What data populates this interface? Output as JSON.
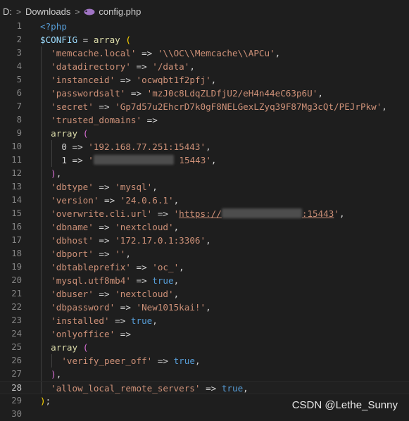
{
  "breadcrumb": {
    "drive": "D:",
    "folder": "Downloads",
    "file": "config.php",
    "file_icon": "php-elephant-icon",
    "separator": ">"
  },
  "editor": {
    "active_line": 28,
    "lines": [
      {
        "n": "1",
        "tokens": [
          [
            "k",
            "<?php"
          ]
        ]
      },
      {
        "n": "2",
        "tokens": [
          [
            "v",
            "$CONFIG"
          ],
          [
            "o",
            " = "
          ],
          [
            "f",
            "array"
          ],
          [
            "o",
            " "
          ],
          [
            "b",
            "("
          ]
        ]
      },
      {
        "n": "3",
        "tokens": [
          [
            "o",
            "  "
          ],
          [
            "s",
            "'memcache.local'"
          ],
          [
            "o",
            " => "
          ],
          [
            "s",
            "'\\\\OC\\\\Memcache\\\\APCu'"
          ],
          [
            "o",
            ","
          ]
        ]
      },
      {
        "n": "4",
        "tokens": [
          [
            "o",
            "  "
          ],
          [
            "s",
            "'datadirectory'"
          ],
          [
            "o",
            " => "
          ],
          [
            "s",
            "'/data'"
          ],
          [
            "o",
            ","
          ]
        ]
      },
      {
        "n": "5",
        "tokens": [
          [
            "o",
            "  "
          ],
          [
            "s",
            "'instanceid'"
          ],
          [
            "o",
            " => "
          ],
          [
            "s",
            "'ocwqbt1f2pfj'"
          ],
          [
            "o",
            ","
          ]
        ]
      },
      {
        "n": "6",
        "tokens": [
          [
            "o",
            "  "
          ],
          [
            "s",
            "'passwordsalt'"
          ],
          [
            "o",
            " => "
          ],
          [
            "s",
            "'mzJ0c8LdqZLDfjU2/eH4n44eC63p6U'"
          ],
          [
            "o",
            ","
          ]
        ]
      },
      {
        "n": "7",
        "tokens": [
          [
            "o",
            "  "
          ],
          [
            "s",
            "'secret'"
          ],
          [
            "o",
            " => "
          ],
          [
            "s",
            "'Gp7d57u2EhcrD7k0gF8NELGexLZyq39F87Mg3cQt/PEJrPkw'"
          ],
          [
            "o",
            ","
          ]
        ]
      },
      {
        "n": "8",
        "tokens": [
          [
            "o",
            "  "
          ],
          [
            "s",
            "'trusted_domains'"
          ],
          [
            "o",
            " =>"
          ]
        ]
      },
      {
        "n": "9",
        "tokens": [
          [
            "o",
            "  "
          ],
          [
            "f",
            "array"
          ],
          [
            "o",
            " "
          ],
          [
            "pb",
            "("
          ]
        ]
      },
      {
        "n": "10",
        "tokens": [
          [
            "o",
            "    0 => "
          ],
          [
            "s",
            "'192.168.77.251:15443'"
          ],
          [
            "o",
            ","
          ]
        ]
      },
      {
        "n": "11",
        "tokens": [
          [
            "o",
            "    1 => "
          ],
          [
            "s",
            "'"
          ],
          [
            "blur",
            "15"
          ],
          [
            "s",
            " 15443'"
          ],
          [
            "o",
            ","
          ]
        ]
      },
      {
        "n": "12",
        "tokens": [
          [
            "o",
            "  "
          ],
          [
            "pb",
            ")"
          ],
          [
            "o",
            ","
          ]
        ]
      },
      {
        "n": "13",
        "tokens": [
          [
            "o",
            "  "
          ],
          [
            "s",
            "'dbtype'"
          ],
          [
            "o",
            " => "
          ],
          [
            "s",
            "'mysql'"
          ],
          [
            "o",
            ","
          ]
        ]
      },
      {
        "n": "14",
        "tokens": [
          [
            "o",
            "  "
          ],
          [
            "s",
            "'version'"
          ],
          [
            "o",
            " => "
          ],
          [
            "s",
            "'24.0.6.1'"
          ],
          [
            "o",
            ","
          ]
        ]
      },
      {
        "n": "15",
        "tokens": [
          [
            "o",
            "  "
          ],
          [
            "s",
            "'overwrite.cli.url'"
          ],
          [
            "o",
            " => "
          ],
          [
            "s",
            "'"
          ],
          [
            "su",
            "https://"
          ],
          [
            "blur",
            "15"
          ],
          [
            "su",
            ":15443"
          ],
          [
            "s",
            "'"
          ],
          [
            "o",
            ","
          ]
        ]
      },
      {
        "n": "16",
        "tokens": [
          [
            "o",
            "  "
          ],
          [
            "s",
            "'dbname'"
          ],
          [
            "o",
            " => "
          ],
          [
            "s",
            "'nextcloud'"
          ],
          [
            "o",
            ","
          ]
        ]
      },
      {
        "n": "17",
        "tokens": [
          [
            "o",
            "  "
          ],
          [
            "s",
            "'dbhost'"
          ],
          [
            "o",
            " => "
          ],
          [
            "s",
            "'172.17.0.1:3306'"
          ],
          [
            "o",
            ","
          ]
        ]
      },
      {
        "n": "18",
        "tokens": [
          [
            "o",
            "  "
          ],
          [
            "s",
            "'dbport'"
          ],
          [
            "o",
            " => "
          ],
          [
            "s",
            "''"
          ],
          [
            "o",
            ","
          ]
        ]
      },
      {
        "n": "19",
        "tokens": [
          [
            "o",
            "  "
          ],
          [
            "s",
            "'dbtableprefix'"
          ],
          [
            "o",
            " => "
          ],
          [
            "s",
            "'oc_'"
          ],
          [
            "o",
            ","
          ]
        ]
      },
      {
        "n": "20",
        "tokens": [
          [
            "o",
            "  "
          ],
          [
            "s",
            "'mysql.utf8mb4'"
          ],
          [
            "o",
            " => "
          ],
          [
            "k",
            "true"
          ],
          [
            "o",
            ","
          ]
        ]
      },
      {
        "n": "21",
        "tokens": [
          [
            "o",
            "  "
          ],
          [
            "s",
            "'dbuser'"
          ],
          [
            "o",
            " => "
          ],
          [
            "s",
            "'nextcloud'"
          ],
          [
            "o",
            ","
          ]
        ]
      },
      {
        "n": "22",
        "tokens": [
          [
            "o",
            "  "
          ],
          [
            "s",
            "'dbpassword'"
          ],
          [
            "o",
            " => "
          ],
          [
            "s",
            "'New1015kai!'"
          ],
          [
            "o",
            ","
          ]
        ]
      },
      {
        "n": "23",
        "tokens": [
          [
            "o",
            "  "
          ],
          [
            "s",
            "'installed'"
          ],
          [
            "o",
            " => "
          ],
          [
            "k",
            "true"
          ],
          [
            "o",
            ","
          ]
        ]
      },
      {
        "n": "24",
        "tokens": [
          [
            "o",
            "  "
          ],
          [
            "s",
            "'onlyoffice'"
          ],
          [
            "o",
            " =>"
          ]
        ]
      },
      {
        "n": "25",
        "tokens": [
          [
            "o",
            "  "
          ],
          [
            "f",
            "array"
          ],
          [
            "o",
            " "
          ],
          [
            "pb",
            "("
          ]
        ]
      },
      {
        "n": "26",
        "tokens": [
          [
            "o",
            "    "
          ],
          [
            "s",
            "'verify_peer_off'"
          ],
          [
            "o",
            " => "
          ],
          [
            "k",
            "true"
          ],
          [
            "o",
            ","
          ]
        ]
      },
      {
        "n": "27",
        "tokens": [
          [
            "o",
            "  "
          ],
          [
            "pb",
            ")"
          ],
          [
            "o",
            ","
          ]
        ]
      },
      {
        "n": "28",
        "tokens": [
          [
            "o",
            "  "
          ],
          [
            "s",
            "'allow_local_remote_servers'"
          ],
          [
            "o",
            " => "
          ],
          [
            "k",
            "true"
          ],
          [
            "o",
            ","
          ]
        ]
      },
      {
        "n": "29",
        "tokens": [
          [
            "b",
            ")"
          ],
          [
            "o",
            ";"
          ]
        ]
      },
      {
        "n": "30",
        "tokens": []
      }
    ]
  },
  "watermark": "CSDN @Lethe_Sunny"
}
